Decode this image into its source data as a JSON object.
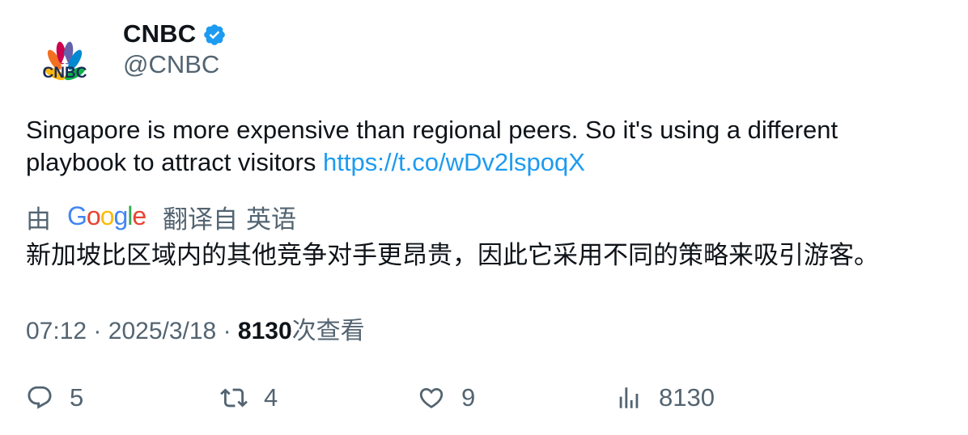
{
  "author": {
    "display_name": "CNBC",
    "handle": "@CNBC",
    "verified": true,
    "avatar_text": "CNBC",
    "verified_color": "#1d9bf0"
  },
  "tweet": {
    "text": "Singapore is more expensive than regional peers. So it's using a different playbook to attract visitors",
    "link": "https://t.co/wDv2lspoqX",
    "link_color": "#1d9bf0"
  },
  "translation": {
    "by_label": "由",
    "provider_logo": "google-logo",
    "translated_from_label": "翻译自",
    "source_language": "英语",
    "translated_text": "新加坡比区域内的其他竞争对手更昂贵，因此它采用不同的策略来吸引游客。"
  },
  "meta": {
    "time": "07:12",
    "date": "2025/3/18",
    "separator": "·",
    "views_count": "8130",
    "views_label": "次查看"
  },
  "actions": {
    "reply": {
      "icon": "reply-icon",
      "count": "5"
    },
    "retweet": {
      "icon": "retweet-icon",
      "count": "4"
    },
    "like": {
      "icon": "heart-icon",
      "count": "9"
    },
    "views": {
      "icon": "analytics-icon",
      "count": "8130"
    }
  }
}
